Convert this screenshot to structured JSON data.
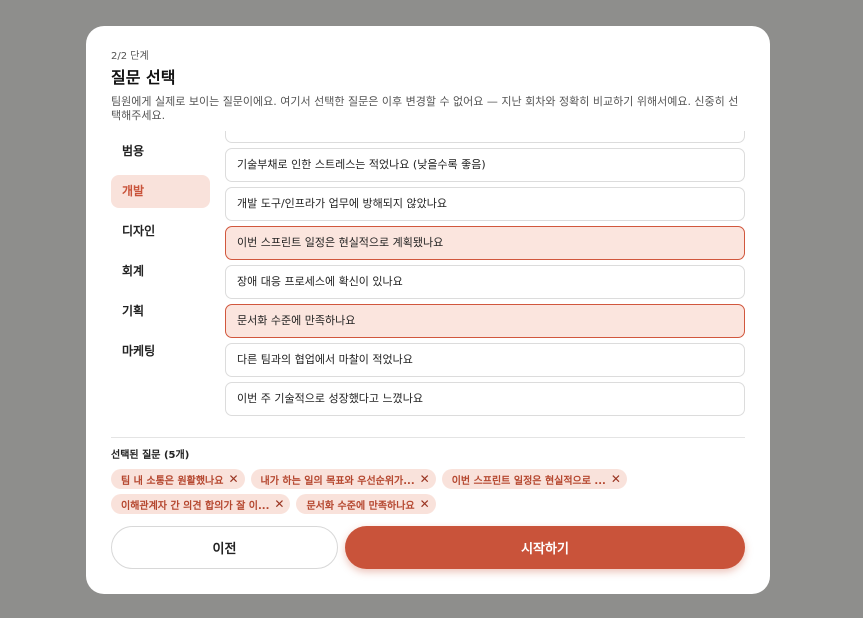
{
  "modal": {
    "step": "2/2 단계",
    "title": "질문 선택",
    "description": "팀원에게 실제로 보이는 질문이에요. 여기서 선택한 질문은 이후 변경할 수 없어요 — 지난 회차와 정확히 비교하기 위해서예요. 신중히 선택해주세요."
  },
  "categories": [
    {
      "label": "범용",
      "active": false
    },
    {
      "label": "개발",
      "active": true
    },
    {
      "label": "디자인",
      "active": false
    },
    {
      "label": "회계",
      "active": false
    },
    {
      "label": "기획",
      "active": false
    },
    {
      "label": "마케팅",
      "active": false
    }
  ],
  "questions": [
    {
      "text": "",
      "selected": false
    },
    {
      "text": "기술부채로 인한 스트레스는 적었나요 (낮을수록 좋음)",
      "selected": false
    },
    {
      "text": "개발 도구/인프라가 업무에 방해되지 않았나요",
      "selected": false
    },
    {
      "text": "이번 스프린트 일정은 현실적으로 계획됐나요",
      "selected": true
    },
    {
      "text": "장애 대응 프로세스에 확신이 있나요",
      "selected": false
    },
    {
      "text": "문서화 수준에 만족하나요",
      "selected": true
    },
    {
      "text": "다른 팀과의 협업에서 마찰이 적었나요",
      "selected": false
    },
    {
      "text": "이번 주 기술적으로 성장했다고 느꼈나요",
      "selected": false
    }
  ],
  "selected": {
    "title": "선택된 질문 (5개)",
    "chips": [
      "팀 내 소통은 원활했나요",
      "내가 하는 일의 목표와 우선순위가...",
      "이번 스프린트 일정은 현실적으로 ...",
      "이해관계자 간 의견 합의가 잘 이...",
      "문서화 수준에 만족하나요"
    ]
  },
  "buttons": {
    "prev": "이전",
    "start": "시작하기"
  }
}
